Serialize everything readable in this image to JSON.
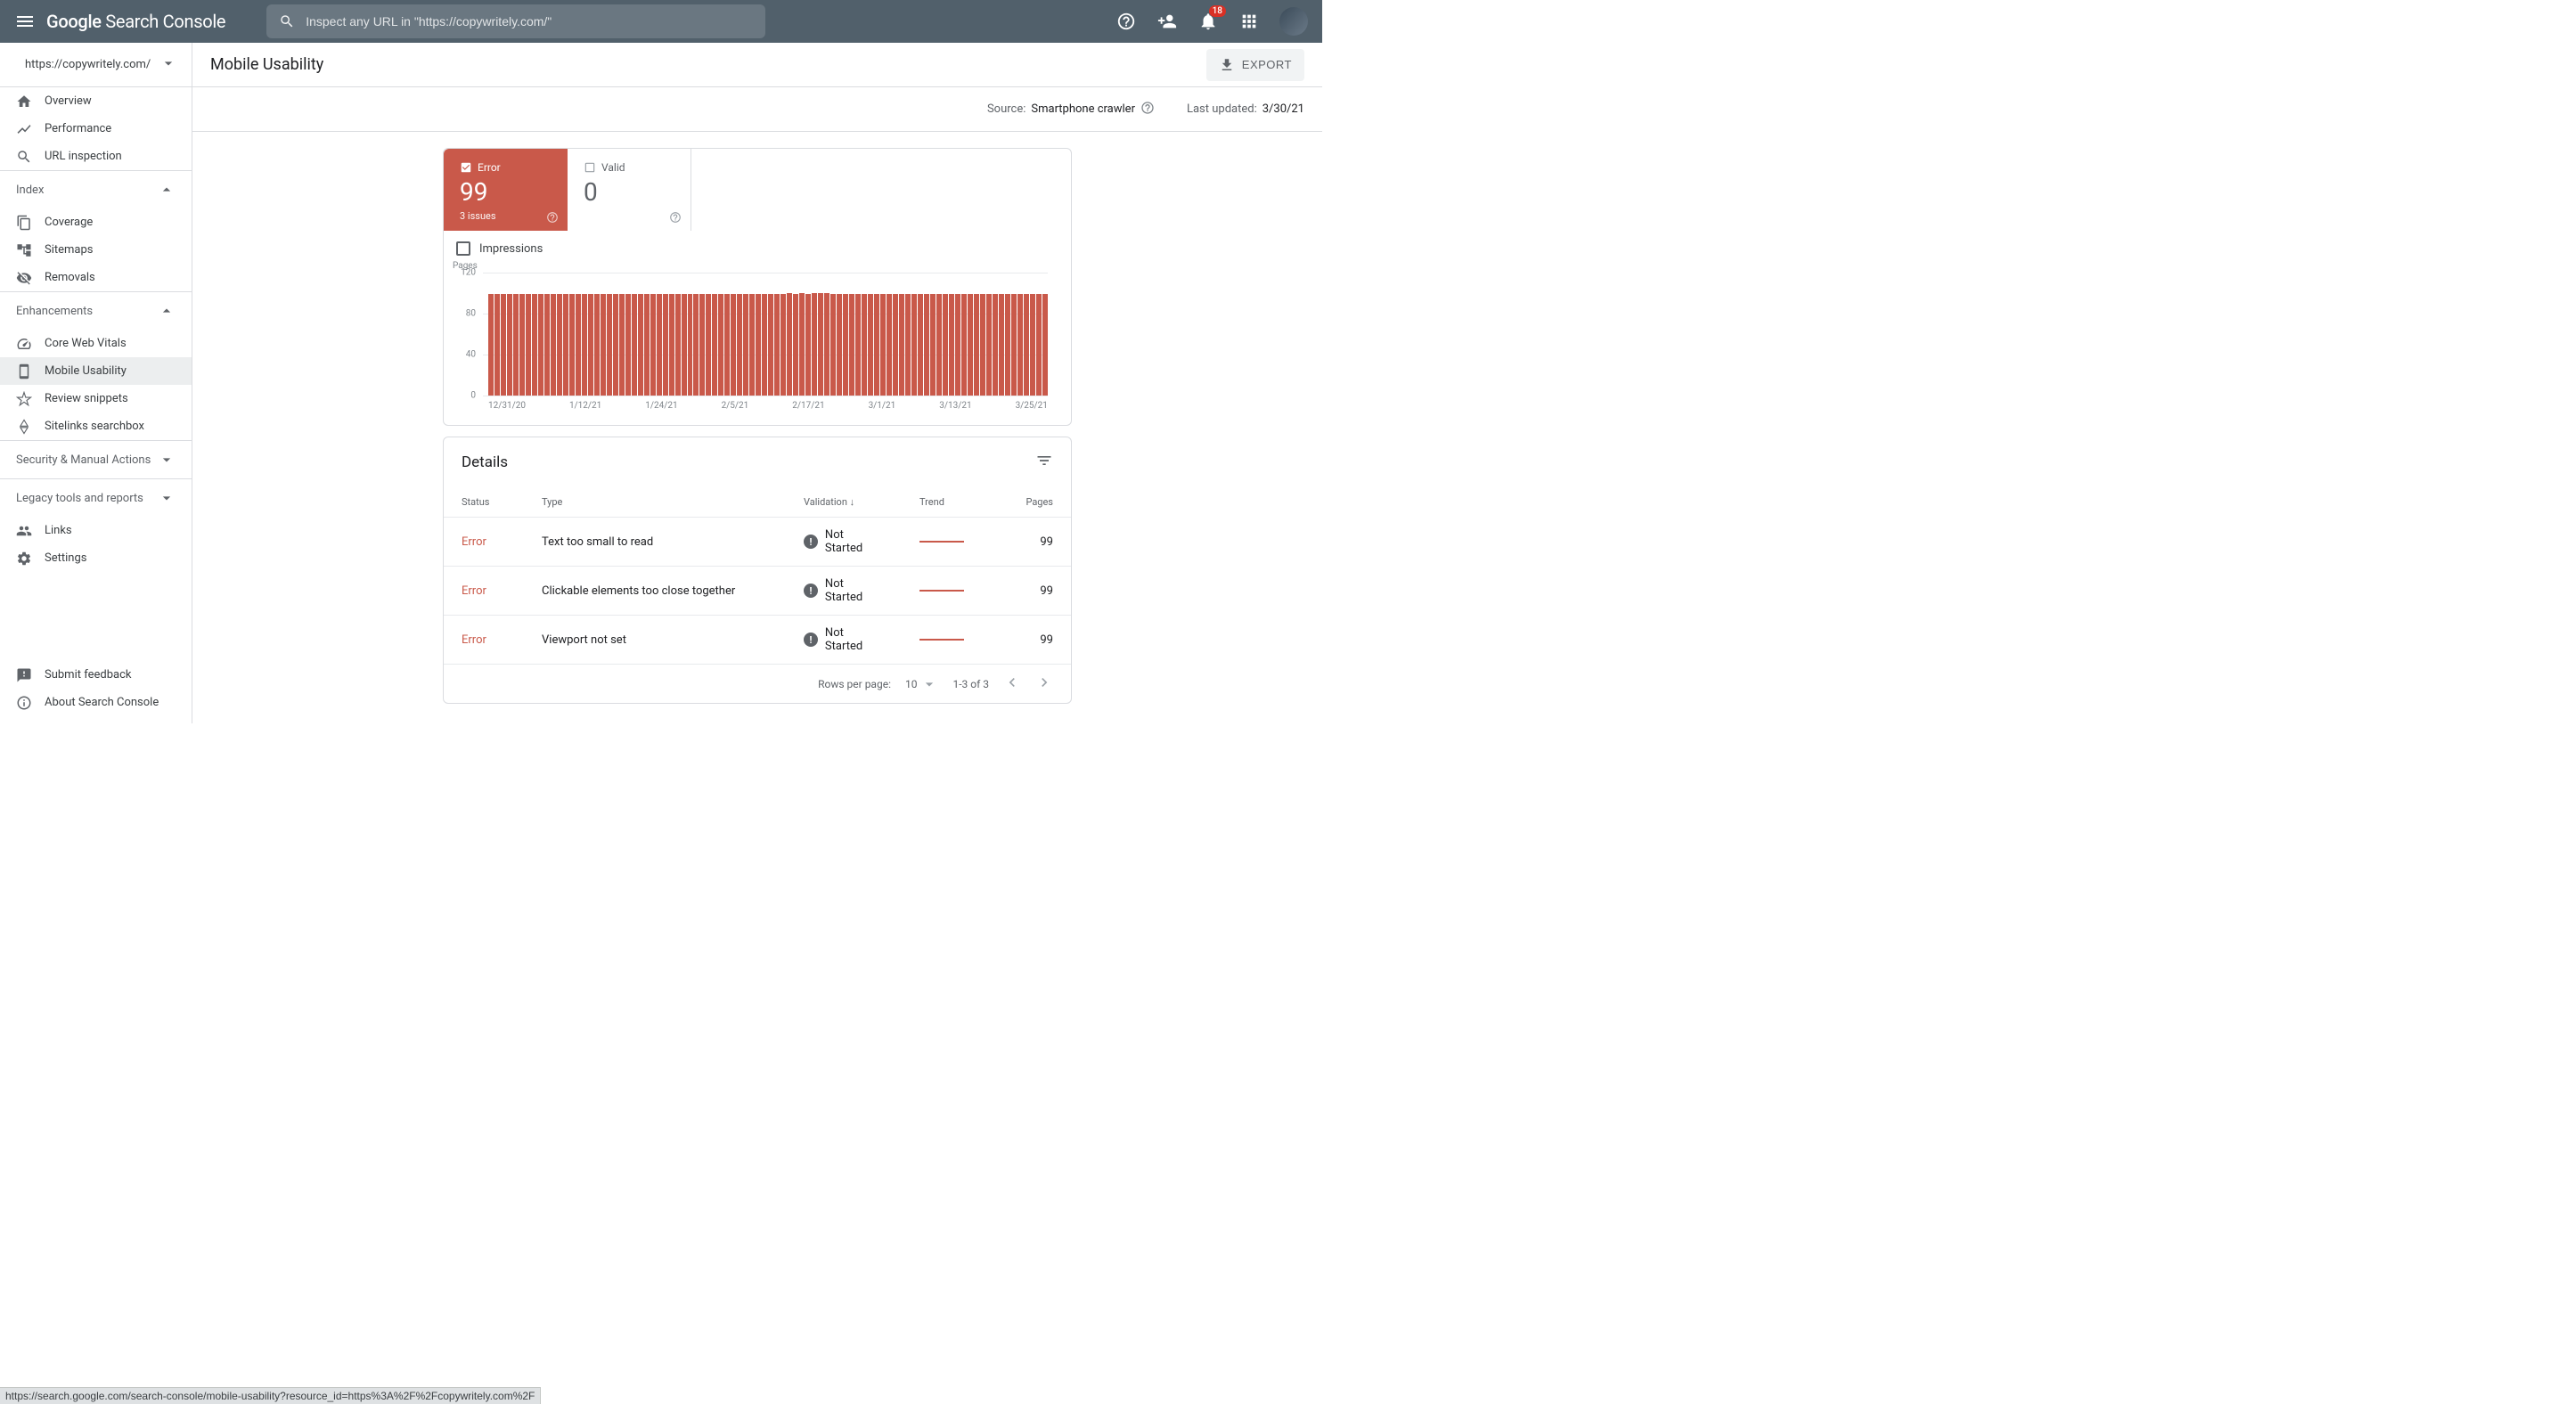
{
  "header": {
    "logo": "Google Search Console",
    "search_placeholder": "Inspect any URL in \"https://copywritely.com/\"",
    "notification_count": "18"
  },
  "sidebar": {
    "property_url": "https://copywritely.com/",
    "items_top": [
      {
        "label": "Overview",
        "icon": "home-icon"
      },
      {
        "label": "Performance",
        "icon": "trend-icon"
      },
      {
        "label": "URL inspection",
        "icon": "search-icon"
      }
    ],
    "section_index": "Index",
    "items_index": [
      {
        "label": "Coverage",
        "icon": "doc-icon"
      },
      {
        "label": "Sitemaps",
        "icon": "sitemap-icon"
      },
      {
        "label": "Removals",
        "icon": "remove-icon"
      }
    ],
    "section_enh": "Enhancements",
    "items_enh": [
      {
        "label": "Core Web Vitals",
        "icon": "speed-icon"
      },
      {
        "label": "Mobile Usability",
        "icon": "phone-icon",
        "active": true
      },
      {
        "label": "Review snippets",
        "icon": "star-icon"
      },
      {
        "label": "Sitelinks searchbox",
        "icon": "sitelinks-icon"
      }
    ],
    "section_sec": "Security & Manual Actions",
    "section_legacy": "Legacy tools and reports",
    "items_bottom": [
      {
        "label": "Links",
        "icon": "links-icon"
      },
      {
        "label": "Settings",
        "icon": "gear-icon"
      }
    ],
    "items_footer": [
      {
        "label": "Submit feedback",
        "icon": "feedback-icon"
      },
      {
        "label": "About Search Console",
        "icon": "info-icon"
      }
    ]
  },
  "page": {
    "title": "Mobile Usability",
    "export": "EXPORT",
    "source_label": "Source:",
    "source_value": "Smartphone crawler",
    "updated_label": "Last updated:",
    "updated_value": "3/30/21"
  },
  "summary": {
    "error_label": "Error",
    "error_count": "99",
    "error_issues": "3 issues",
    "valid_label": "Valid",
    "valid_count": "0",
    "impressions_label": "Impressions"
  },
  "chart_data": {
    "type": "bar",
    "title": "",
    "xlabel": "",
    "ylabel": "Pages",
    "ylim": [
      0,
      120
    ],
    "yticks": [
      0,
      40,
      80,
      120
    ],
    "categories_labeled": [
      "12/31/20",
      "1/12/21",
      "1/24/21",
      "2/5/21",
      "2/17/21",
      "3/1/21",
      "3/13/21",
      "3/25/21"
    ],
    "values": [
      99,
      99,
      99,
      99,
      99,
      99,
      99,
      99,
      99,
      99,
      99,
      99,
      99,
      99,
      99,
      99,
      99,
      99,
      99,
      99,
      99,
      99,
      99,
      99,
      99,
      99,
      99,
      99,
      99,
      99,
      99,
      99,
      99,
      99,
      99,
      99,
      99,
      99,
      99,
      99,
      99,
      99,
      99,
      99,
      99,
      99,
      99,
      99,
      100,
      99,
      100,
      99,
      100,
      100,
      100,
      99,
      99,
      99,
      99,
      99,
      99,
      99,
      99,
      99,
      99,
      99,
      99,
      99,
      99,
      99,
      99,
      99,
      99,
      99,
      99,
      99,
      99,
      99,
      99,
      99,
      99,
      99,
      99,
      99,
      99,
      99,
      99,
      99,
      99,
      99
    ]
  },
  "details": {
    "title": "Details",
    "cols": {
      "status": "Status",
      "type": "Type",
      "validation": "Validation",
      "trend": "Trend",
      "pages": "Pages"
    },
    "rows": [
      {
        "status": "Error",
        "type": "Text too small to read",
        "validation": "Not Started",
        "pages": "99"
      },
      {
        "status": "Error",
        "type": "Clickable elements too close together",
        "validation": "Not Started",
        "pages": "99"
      },
      {
        "status": "Error",
        "type": "Viewport not set",
        "validation": "Not Started",
        "pages": "99"
      }
    ],
    "pager": {
      "rows_label": "Rows per page:",
      "rows_value": "10",
      "range": "1-3 of 3"
    }
  },
  "status_url": "https://search.google.com/search-console/mobile-usability?resource_id=https%3A%2F%2Fcopywritely.com%2F"
}
